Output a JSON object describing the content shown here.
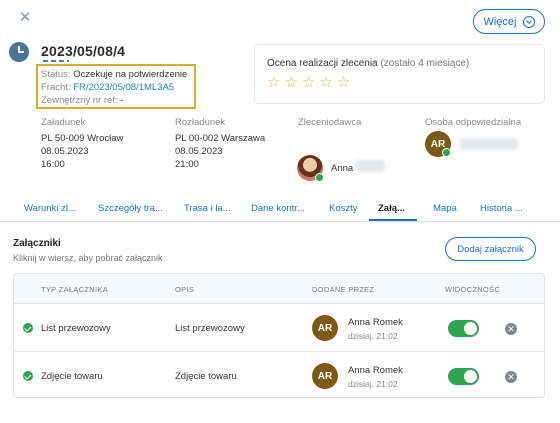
{
  "header": {
    "close_label": "✕",
    "more_button": "Więcej",
    "order_date": "2023/05/08/4"
  },
  "status": {
    "status_label": "Status:",
    "status_value": "Oczekuje na potwierdzenie",
    "freight_label": "Fracht:",
    "freight_value": "FR/2023/05/08/1ML3A5",
    "external_label": "Zewnętrzny nr ref:",
    "external_value": "-"
  },
  "rating": {
    "title": "Ocena realizacji zlecenia",
    "remaining": "(zostało 4 miesiące)",
    "stars": [
      "☆",
      "☆",
      "☆",
      "☆",
      "☆"
    ],
    "star_color": "#e2b32c"
  },
  "loading": {
    "header": "Załadunek",
    "place": "PL 50-009 Wrocław",
    "date": "08.05.2023",
    "time": "16:00"
  },
  "unloading": {
    "header": "Rozładunek",
    "place": "PL 00-002 Warszawa",
    "date": "08.05.2023",
    "time": "21:00"
  },
  "client": {
    "header": "Zleceniodawca",
    "name": "Anna"
  },
  "responsible": {
    "header": "Osoba odpowiedzialna",
    "initials": "AR"
  },
  "tabs": [
    {
      "label": "Warunki zl..."
    },
    {
      "label": "Szczegóły tra..."
    },
    {
      "label": "Trasa i ła..."
    },
    {
      "label": "Dane kontr..."
    },
    {
      "label": "Koszty"
    },
    {
      "label": "Załą..."
    },
    {
      "label": "Mapa"
    },
    {
      "label": "Historia ..."
    }
  ],
  "attachments": {
    "title": "Załączniki",
    "subtitle": "Kliknij w wiersz, aby pobrać załącznik",
    "add_button": "Dodaj załącznik",
    "columns": [
      "TYP ZAŁĄCZNIKA",
      "OPIS",
      "DODANE PRZEZ",
      "WIDOCZNOŚĆ"
    ],
    "rows": [
      {
        "type": "List przewozowy",
        "description": "List przewozowy",
        "initials": "AR",
        "added_by": "Anna Romek",
        "added_at": "dzisiaj, 21:02",
        "visible": true,
        "delete_label": "✕"
      },
      {
        "type": "Zdjęcie towaru",
        "description": "Zdjęcie towaru",
        "initials": "AR",
        "added_by": "Anna Romek",
        "added_at": "dzisiaj, 21:02",
        "visible": true,
        "delete_label": "✕"
      }
    ]
  },
  "colors": {
    "accent": "#1d6fc9",
    "highlight_border": "#d4ad2a",
    "success": "#2ea44f",
    "avatar_bg": "#7a5a14"
  }
}
